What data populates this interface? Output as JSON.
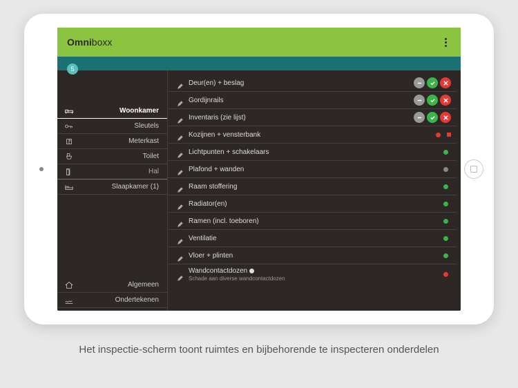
{
  "app": {
    "title_omni": "Omni",
    "title_boxx": "boxx"
  },
  "badge_count": "5",
  "sidebar": {
    "rooms": [
      {
        "id": "woonkamer",
        "label": "Woonkamer",
        "active": true
      },
      {
        "id": "sleutels",
        "label": "Sleutels"
      },
      {
        "id": "meterkast",
        "label": "Meterkast"
      },
      {
        "id": "toilet",
        "label": "Toilet"
      },
      {
        "id": "hal",
        "label": "Hal",
        "special": true
      },
      {
        "id": "slaapkamer1",
        "label": "Slaapkamer (1)"
      }
    ],
    "bottom": [
      {
        "id": "algemeen",
        "label": "Algemeen"
      },
      {
        "id": "ondertekenen",
        "label": "Ondertekenen"
      }
    ]
  },
  "items": [
    {
      "label": "Deur(en) + beslag",
      "state": "triage"
    },
    {
      "label": "Gordijnrails",
      "state": "triage"
    },
    {
      "label": "Inventaris (zie lijst)",
      "state": "triage"
    },
    {
      "label": "Kozijnen + vensterbank",
      "state": "red-sq"
    },
    {
      "label": "Lichtpunten + schakelaars",
      "state": "green"
    },
    {
      "label": "Plafond + wanden",
      "state": "grey"
    },
    {
      "label": "Raam stoffering",
      "state": "green"
    },
    {
      "label": "Radiator(en)",
      "state": "green"
    },
    {
      "label": "Ramen (incl. toeboren)",
      "state": "green"
    },
    {
      "label": "Ventilatie",
      "state": "green"
    },
    {
      "label": "Vloer + plinten",
      "state": "green"
    },
    {
      "label": "Wandcontactdozen",
      "sub": "Schade aan diverse wandcontactdozen",
      "state": "red",
      "bullet": true
    }
  ],
  "caption": "Het inspectie-scherm toont ruimtes en bijbehorende te inspecteren onderdelen"
}
